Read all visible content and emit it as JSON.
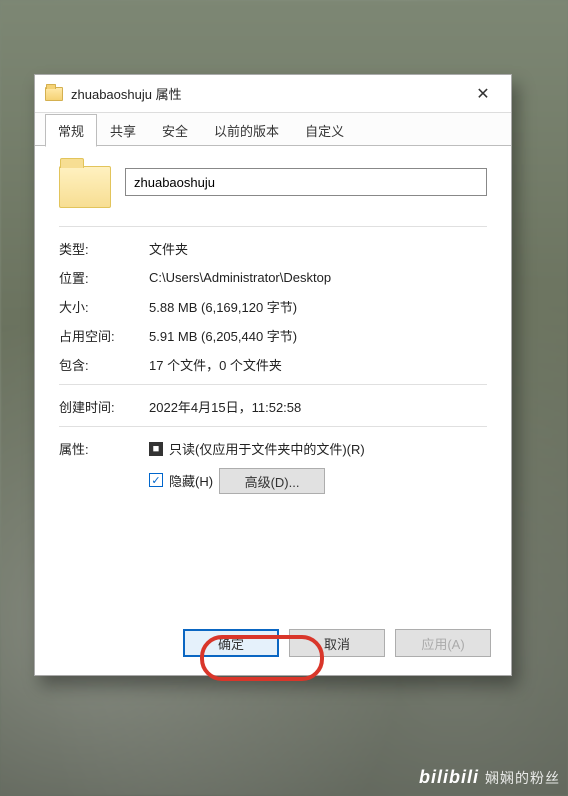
{
  "titlebar": {
    "title": "zhuabaoshuju 属性"
  },
  "tabs": {
    "items": [
      "常规",
      "共享",
      "安全",
      "以前的版本",
      "自定义"
    ],
    "active": 0
  },
  "general": {
    "name": "zhuabaoshuju",
    "type_label": "类型:",
    "type_value": "文件夹",
    "loc_label": "位置:",
    "loc_value": "C:\\Users\\Administrator\\Desktop",
    "size_label": "大小:",
    "size_value": "5.88 MB (6,169,120 字节)",
    "disk_label": "占用空间:",
    "disk_value": "5.91 MB (6,205,440 字节)",
    "contains_label": "包含:",
    "contains_value": "17 个文件，0 个文件夹",
    "created_label": "创建时间:",
    "created_value": "2022年4月15日，11:52:58",
    "attr_label": "属性:",
    "readonly_label": "只读(仅应用于文件夹中的文件)(R)",
    "hidden_label": "隐藏(H)",
    "advanced_label": "高级(D)..."
  },
  "buttons": {
    "ok": "确定",
    "cancel": "取消",
    "apply": "应用(A)"
  },
  "watermark": {
    "logo": "bilibili",
    "text": "娴娴的粉丝"
  }
}
